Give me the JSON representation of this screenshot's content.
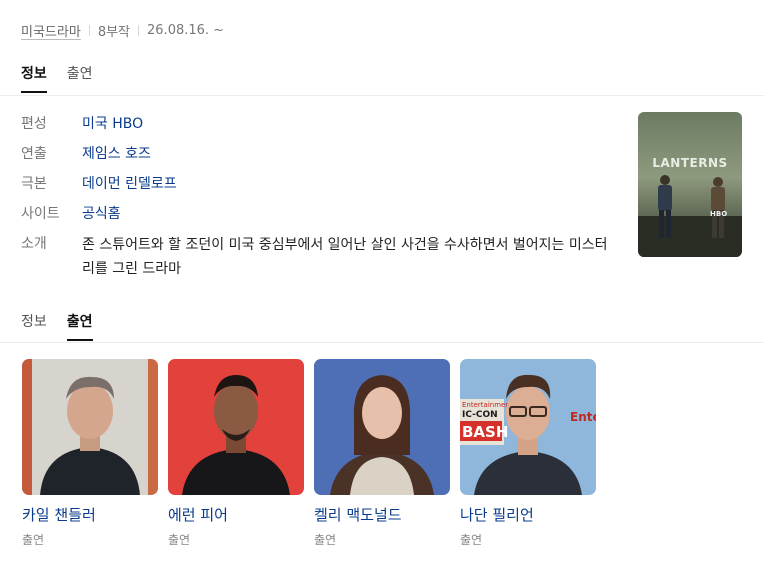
{
  "meta": {
    "genre": "미국드라마",
    "episodes": "8부작",
    "date": "26.08.16. ~"
  },
  "tabs_top": [
    {
      "label": "정보"
    },
    {
      "label": "출연"
    }
  ],
  "info": {
    "rows": [
      {
        "label": "편성",
        "value": "미국 HBO"
      },
      {
        "label": "연출",
        "value": "제임스 호즈"
      },
      {
        "label": "극본",
        "value": "데이먼 린델로프"
      },
      {
        "label": "사이트",
        "value": "공식홈"
      }
    ],
    "desc_label": "소개",
    "description": "존 스튜어트와 할 조던이 미국 중심부에서 일어난 살인 사건을 수사하면서 벌어지는 미스터리를 그린 드라마"
  },
  "poster": {
    "title": "LANTERNS",
    "brand": "HBO"
  },
  "tabs_bottom": [
    {
      "label": "정보"
    },
    {
      "label": "출연"
    }
  ],
  "cast": [
    {
      "name": "카일 챈들러",
      "role": "출연"
    },
    {
      "name": "에런 피어",
      "role": "출연"
    },
    {
      "name": "켈리 맥도널드",
      "role": "출연"
    },
    {
      "name": "나단 필리언",
      "role": "출연",
      "backdrop_text": [
        "Entertainment",
        "IC-CON",
        "BASH",
        "Ente"
      ]
    }
  ],
  "colors": {
    "link": "#0b3c8c",
    "accent_tab": "#111111",
    "backdrop_red": "#e2413c",
    "backdrop_blue": "#4e6fb6"
  }
}
